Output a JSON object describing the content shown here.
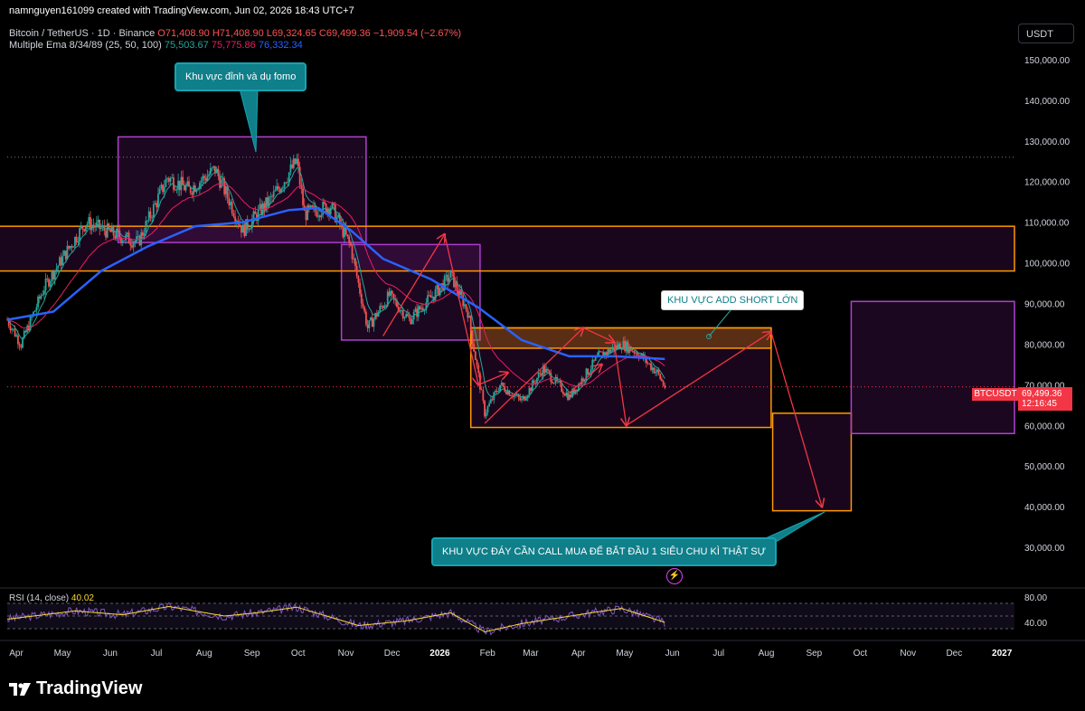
{
  "header": {
    "author_line": "namnguyen161099 created with TradingView.com, Jun 02, 2026 18:43 UTC+7",
    "symbol": "Bitcoin / TetherUS · 1D · Binance",
    "ohlc": {
      "o": "O71,408.90",
      "h": "H71,408.90",
      "l": "L69,324.65",
      "c": "C69,499.36",
      "chg": "−1,909.54 (−2.67%)"
    },
    "ema_label": "Multiple Ema 8/34/89 (25, 50, 100)",
    "ema_values": [
      "75,503.67",
      "75,775.86",
      "76,332.34"
    ]
  },
  "currency_button": "USDT",
  "price_axis": [
    "150,000.00",
    "140,000.00",
    "130,000.00",
    "120,000.00",
    "110,000.00",
    "100,000.00",
    "90,000.00",
    "80,000.00",
    "70,000.00",
    "60,000.00",
    "50,000.00",
    "40,000.00",
    "30,000.00"
  ],
  "time_axis": [
    "Apr",
    "May",
    "Jun",
    "Jul",
    "Aug",
    "Sep",
    "Oct",
    "Nov",
    "Dec",
    "2026",
    "Feb",
    "Mar",
    "Apr",
    "May",
    "Jun",
    "Jul",
    "Aug",
    "Sep",
    "Oct",
    "Nov",
    "Dec",
    "2027"
  ],
  "last_price": {
    "ticker": "BTCUSDT",
    "price": "69,499.36",
    "countdown": "12:16:45"
  },
  "annotations": {
    "top_zone": "Khu vực đỉnh và dụ fomo",
    "add_short": "KHU VỰC ADD SHORT LỚN",
    "bottom_zone": "KHU VỰC ĐÁY CẦN CALL MUA ĐỂ BẮT ĐẦU 1 SIÊU CHU KÌ THẬT SỰ"
  },
  "rsi": {
    "label": "RSI (14, close)",
    "value": "40.02",
    "axis": [
      "80.00",
      "40.00"
    ]
  },
  "brand": "TradingView",
  "colors": {
    "bg": "#000000",
    "up": "#26a69a",
    "down": "#ef5350",
    "ema_fast": "#26a69a",
    "ema_mid": "#e91e63",
    "ema_slow": "#2962ff",
    "zone_purple": "#9c27b0",
    "zone_orange": "#ff9800",
    "arrow": "#f23645",
    "rsi": "#7e57c2",
    "rsi_ma": "#fdd835"
  },
  "chart_data": {
    "type": "candlestick",
    "title": "Bitcoin / TetherUS · 1D · Binance",
    "ylim": [
      20000,
      158000
    ],
    "x_range": [
      "2025-04-01",
      "2027-01-15"
    ],
    "price_path": [
      {
        "d": "2025-04-01",
        "v": 86000
      },
      {
        "d": "2025-04-10",
        "v": 80000
      },
      {
        "d": "2025-04-25",
        "v": 94000
      },
      {
        "d": "2025-05-10",
        "v": 103000
      },
      {
        "d": "2025-05-22",
        "v": 110000
      },
      {
        "d": "2025-06-10",
        "v": 107000
      },
      {
        "d": "2025-06-25",
        "v": 105000
      },
      {
        "d": "2025-07-14",
        "v": 121000
      },
      {
        "d": "2025-07-28",
        "v": 118000
      },
      {
        "d": "2025-08-14",
        "v": 123000
      },
      {
        "d": "2025-09-01",
        "v": 108000
      },
      {
        "d": "2025-09-20",
        "v": 116000
      },
      {
        "d": "2025-10-06",
        "v": 125000
      },
      {
        "d": "2025-10-11",
        "v": 112000
      },
      {
        "d": "2025-10-28",
        "v": 114000
      },
      {
        "d": "2025-11-10",
        "v": 104000
      },
      {
        "d": "2025-11-21",
        "v": 84000
      },
      {
        "d": "2025-12-05",
        "v": 92000
      },
      {
        "d": "2025-12-18",
        "v": 86000
      },
      {
        "d": "2026-01-05",
        "v": 93000
      },
      {
        "d": "2026-01-14",
        "v": 97000
      },
      {
        "d": "2026-01-25",
        "v": 88000
      },
      {
        "d": "2026-02-05",
        "v": 63000
      },
      {
        "d": "2026-02-15",
        "v": 70000
      },
      {
        "d": "2026-03-01",
        "v": 66000
      },
      {
        "d": "2026-03-15",
        "v": 74000
      },
      {
        "d": "2026-04-01",
        "v": 67000
      },
      {
        "d": "2026-04-20",
        "v": 77000
      },
      {
        "d": "2026-05-05",
        "v": 80000
      },
      {
        "d": "2026-05-15",
        "v": 78000
      },
      {
        "d": "2026-05-28",
        "v": 73000
      },
      {
        "d": "2026-06-02",
        "v": 69499
      }
    ],
    "ema_slow_path": [
      {
        "d": "2025-04-01",
        "v": 86000
      },
      {
        "d": "2025-05-01",
        "v": 88000
      },
      {
        "d": "2025-06-01",
        "v": 98000
      },
      {
        "d": "2025-07-01",
        "v": 104000
      },
      {
        "d": "2025-08-01",
        "v": 109000
      },
      {
        "d": "2025-09-01",
        "v": 110000
      },
      {
        "d": "2025-10-01",
        "v": 113000
      },
      {
        "d": "2025-10-20",
        "v": 113500
      },
      {
        "d": "2025-11-10",
        "v": 108000
      },
      {
        "d": "2025-12-01",
        "v": 101000
      },
      {
        "d": "2026-01-01",
        "v": 96000
      },
      {
        "d": "2026-02-01",
        "v": 89000
      },
      {
        "d": "2026-03-01",
        "v": 81000
      },
      {
        "d": "2026-04-01",
        "v": 77000
      },
      {
        "d": "2026-05-01",
        "v": 77000
      },
      {
        "d": "2026-06-02",
        "v": 76332
      }
    ],
    "zones": [
      {
        "kind": "purple",
        "x0": "2025-06-12",
        "x1": "2025-11-20",
        "y0": 105000,
        "y1": 131000
      },
      {
        "kind": "purple",
        "x0": "2025-11-04",
        "x1": "2026-02-02",
        "y0": 81000,
        "y1": 104500
      },
      {
        "kind": "orange",
        "x0": "2025-03-25",
        "x1": "2027-01-15",
        "y0": 98000,
        "y1": 109000
      },
      {
        "kind": "orange",
        "x0": "2026-01-27",
        "x1": "2026-08-10",
        "y0": 59500,
        "y1": 84000
      },
      {
        "kind": "orange_fill",
        "x0": "2026-01-27",
        "x1": "2026-08-10",
        "y0": 79000,
        "y1": 84000
      },
      {
        "kind": "orange",
        "x0": "2026-08-11",
        "x1": "2026-10-01",
        "y0": 39000,
        "y1": 63000
      },
      {
        "kind": "purple",
        "x0": "2026-10-01",
        "x1": "2027-01-15",
        "y0": 58000,
        "y1": 90500
      }
    ],
    "arrows": [
      {
        "x0": "2025-12-01",
        "y0": 82000,
        "x1": "2026-01-10",
        "y1": 107000
      },
      {
        "x0": "2026-01-10",
        "y0": 107000,
        "x1": "2026-02-01",
        "y1": 70000
      },
      {
        "x0": "2026-02-01",
        "y0": 70000,
        "x1": "2026-02-20",
        "y1": 73000
      },
      {
        "x0": "2026-02-05",
        "y0": 60500,
        "x1": "2026-04-10",
        "y1": 84000
      },
      {
        "x0": "2026-04-10",
        "y0": 84000,
        "x1": "2026-04-30",
        "y1": 80500
      },
      {
        "x0": "2026-04-30",
        "y0": 80500,
        "x1": "2026-05-08",
        "y1": 60000
      },
      {
        "x0": "2026-05-08",
        "y0": 60000,
        "x1": "2026-08-10",
        "y1": 83000
      },
      {
        "x0": "2026-08-10",
        "y0": 83000,
        "x1": "2026-09-12",
        "y1": 40000
      },
      {
        "x0": "2026-04-01",
        "y0": 68000,
        "x1": "2026-04-22",
        "y1": 75000
      }
    ],
    "dotted_levels": [
      126000,
      69499
    ],
    "rsi_path": [
      {
        "d": "2025-04-01",
        "v": 45
      },
      {
        "d": "2025-05-15",
        "v": 58
      },
      {
        "d": "2025-06-15",
        "v": 52
      },
      {
        "d": "2025-07-15",
        "v": 65
      },
      {
        "d": "2025-08-20",
        "v": 50
      },
      {
        "d": "2025-09-10",
        "v": 55
      },
      {
        "d": "2025-10-06",
        "v": 64
      },
      {
        "d": "2025-11-15",
        "v": 35
      },
      {
        "d": "2025-12-15",
        "v": 42
      },
      {
        "d": "2026-01-14",
        "v": 55
      },
      {
        "d": "2026-02-05",
        "v": 25
      },
      {
        "d": "2026-03-01",
        "v": 38
      },
      {
        "d": "2026-04-15",
        "v": 55
      },
      {
        "d": "2026-05-05",
        "v": 62
      },
      {
        "d": "2026-06-02",
        "v": 40
      }
    ]
  }
}
